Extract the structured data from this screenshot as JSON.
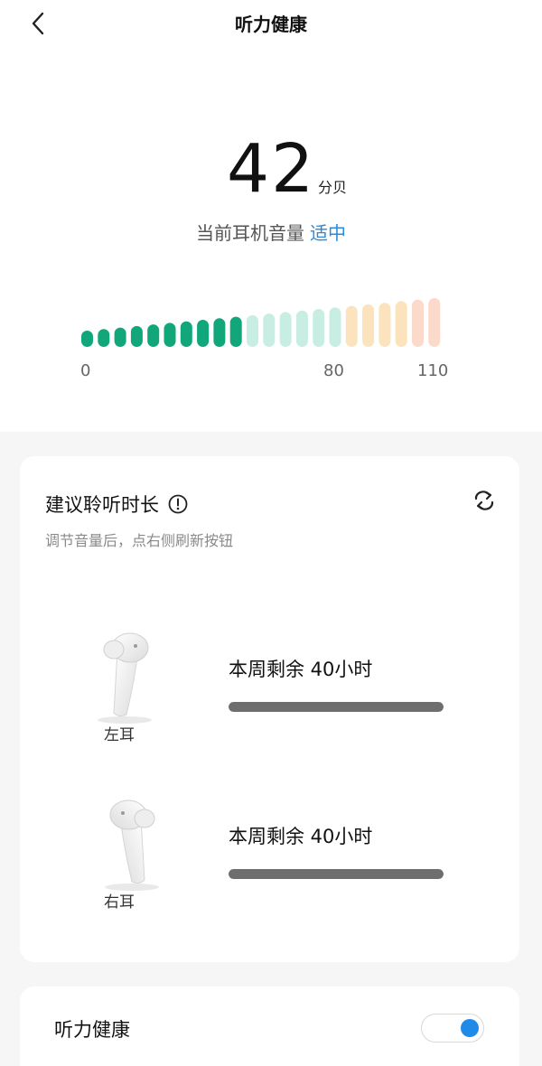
{
  "header": {
    "title": "听力健康",
    "back_icon": "chevron-left-icon"
  },
  "volume": {
    "value": "42",
    "unit": "分贝",
    "status_prefix": "当前耳机音量",
    "status_level": "适中",
    "status_color": "#2a8bdc",
    "scale_labels": [
      "0",
      "80",
      "110"
    ],
    "meter": {
      "segments_total": 22,
      "segments_active": 10,
      "colors": {
        "active": "#11a77a",
        "safe_inactive": "#c8eee4",
        "warn_inactive": "#fbe3be",
        "loud_inactive": "#fbd9cb"
      }
    }
  },
  "listening_card": {
    "title": "建议聆听时长",
    "info_icon": "info-icon",
    "hint": "调节音量后，点右侧刷新按钮",
    "refresh_icon": "refresh-icon",
    "left": {
      "label": "左耳",
      "remaining": "本周剩余 40小时",
      "progress": 1.0
    },
    "right": {
      "label": "右耳",
      "remaining": "本周剩余 40小时",
      "progress": 1.0
    }
  },
  "hearing_toggle": {
    "label": "听力健康",
    "enabled": true,
    "accent": "#1f8ae8"
  }
}
